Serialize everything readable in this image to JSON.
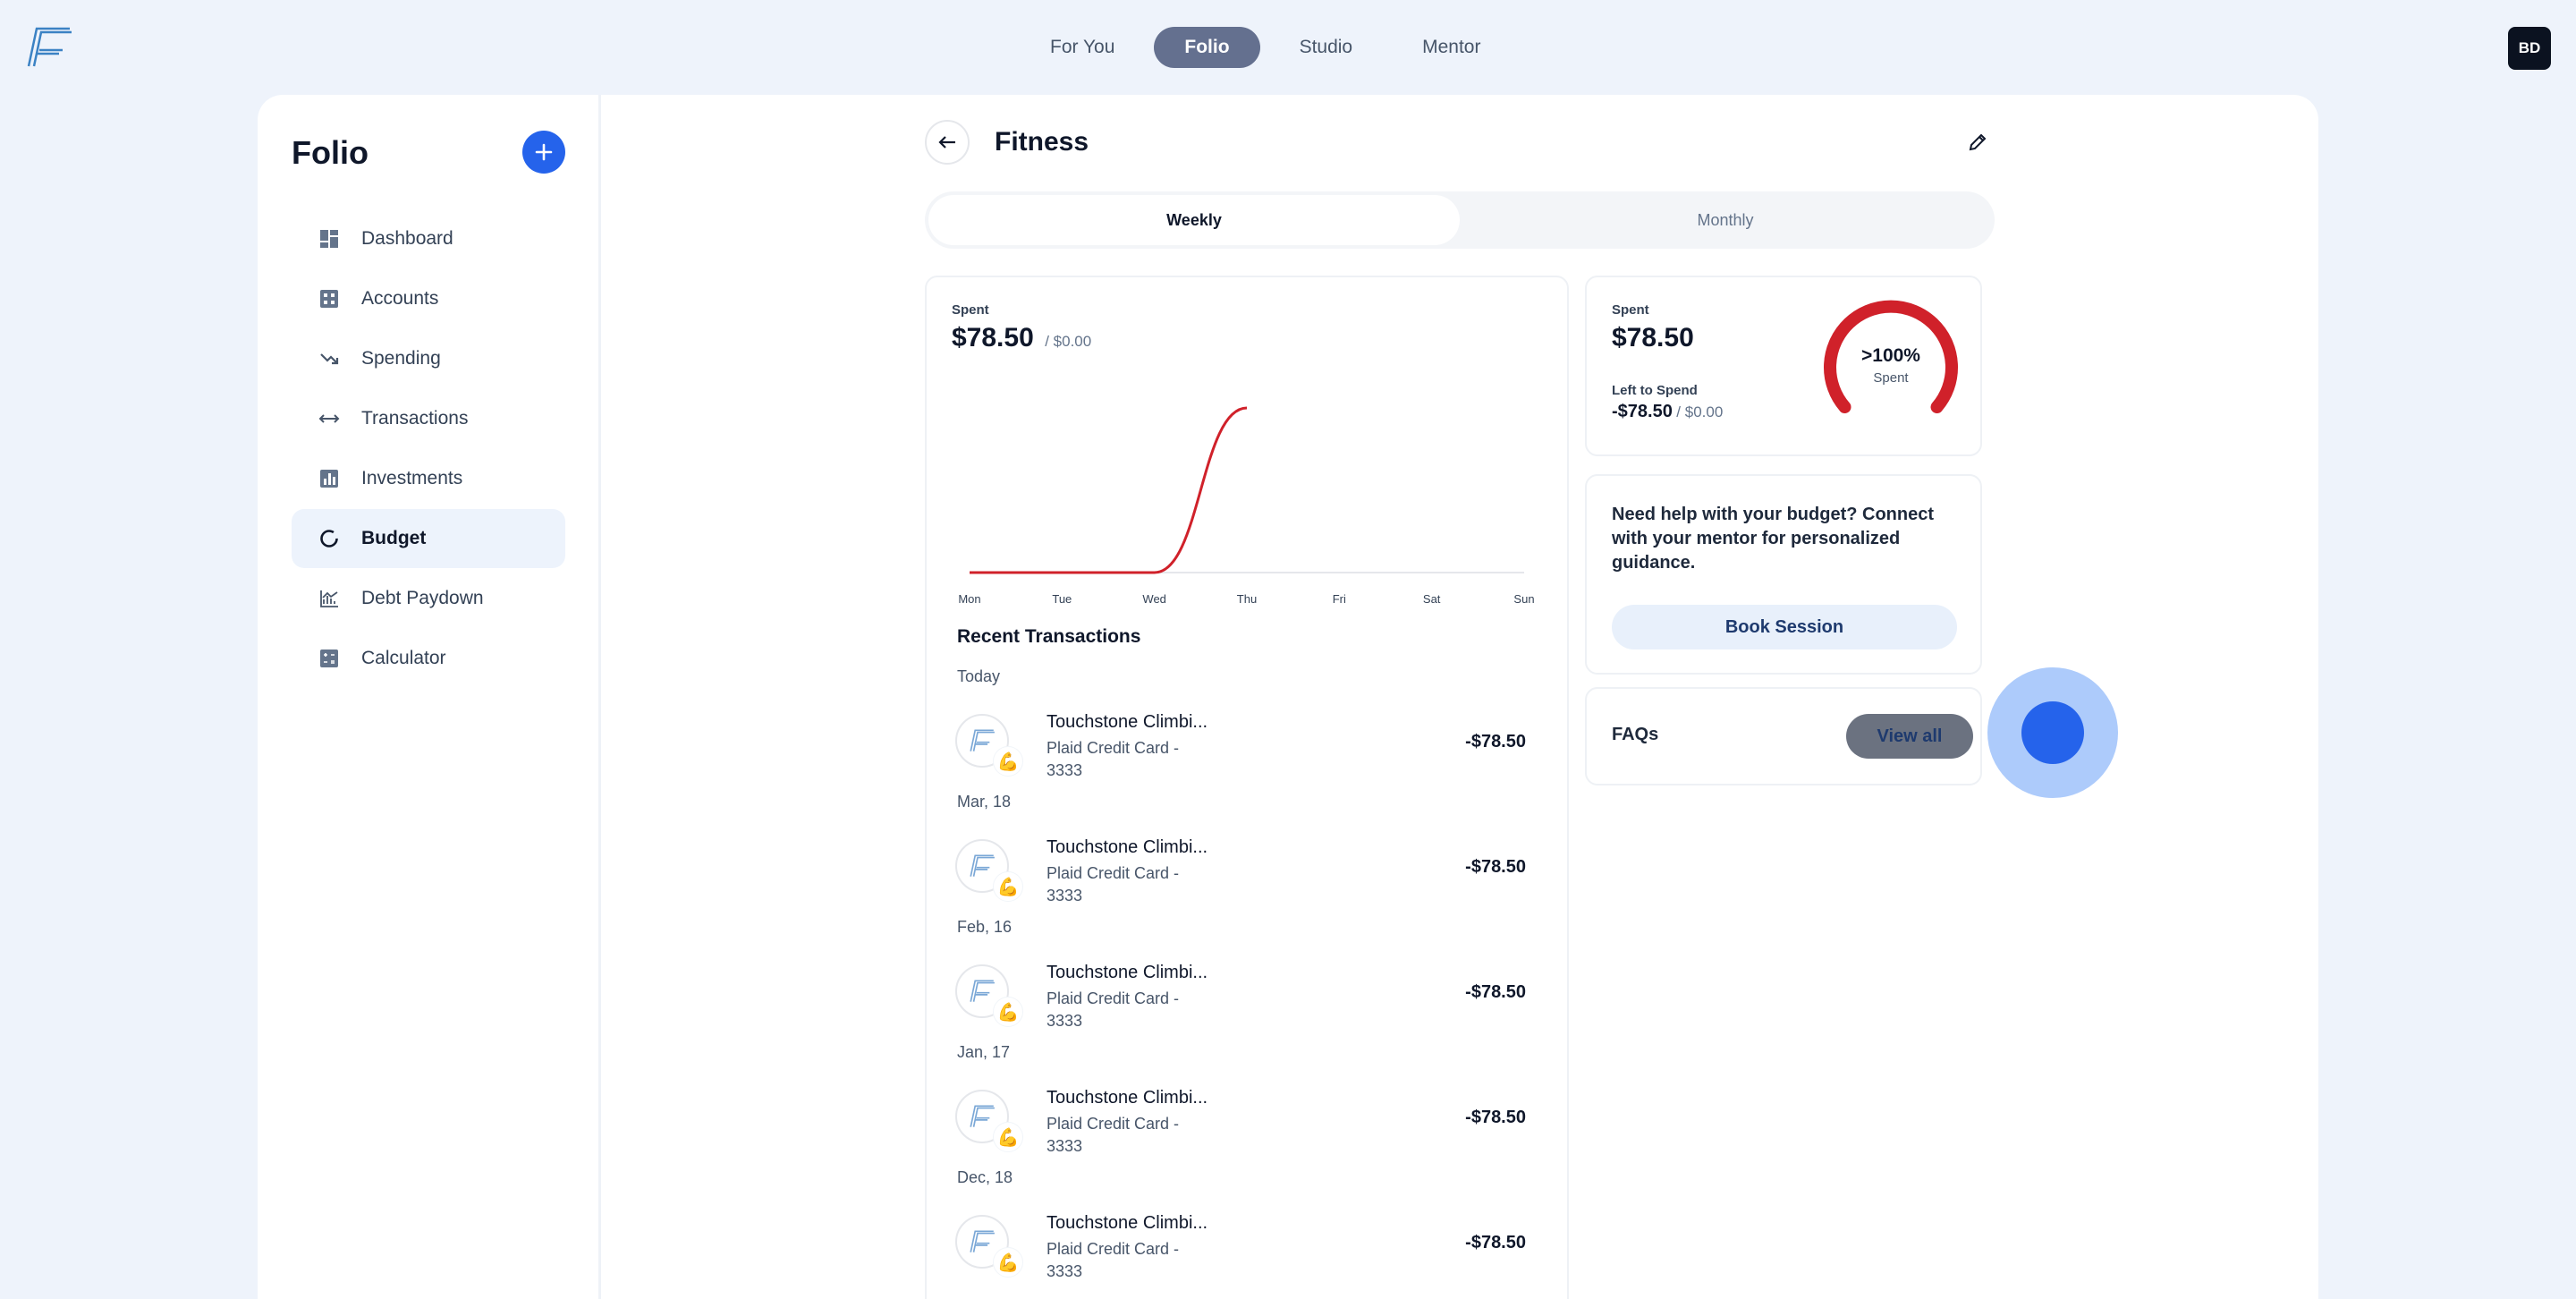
{
  "topnav": {
    "tabs": [
      {
        "label": "For You"
      },
      {
        "label": "Folio",
        "active": true
      },
      {
        "label": "Studio"
      },
      {
        "label": "Mentor"
      }
    ],
    "avatar_initials": "BD"
  },
  "sidebar": {
    "title": "Folio",
    "items": [
      {
        "label": "Dashboard",
        "icon": "dashboard-icon"
      },
      {
        "label": "Accounts",
        "icon": "accounts-icon"
      },
      {
        "label": "Spending",
        "icon": "trend-down-icon"
      },
      {
        "label": "Transactions",
        "icon": "arrows-horizontal-icon"
      },
      {
        "label": "Investments",
        "icon": "bar-chart-icon"
      },
      {
        "label": "Budget",
        "icon": "donut-icon",
        "active": true
      },
      {
        "label": "Debt Paydown",
        "icon": "line-chart-icon"
      },
      {
        "label": "Calculator",
        "icon": "calculator-icon"
      }
    ]
  },
  "page": {
    "title": "Fitness",
    "period_options": [
      "Weekly",
      "Monthly"
    ],
    "active_period": "Weekly"
  },
  "spent_card": {
    "label": "Spent",
    "amount": "$78.50",
    "budget": "/ $0.00"
  },
  "chart_data": {
    "type": "line",
    "categories": [
      "Mon",
      "Tue",
      "Wed",
      "Thu",
      "Fri",
      "Sat",
      "Sun"
    ],
    "series": [
      {
        "values": [
          0,
          0,
          0,
          78.5,
          null,
          null,
          null
        ]
      }
    ],
    "ylim": [
      0,
      78.5
    ],
    "grid": false,
    "color": "#d0212a"
  },
  "recent": {
    "title": "Recent Transactions",
    "groups": [
      {
        "date": "Today",
        "name": "Touchstone Climbi...",
        "account": "Plaid Credit Card - 3333",
        "amount": "-$78.50",
        "emoji": "💪"
      },
      {
        "date": "Mar, 18",
        "name": "Touchstone Climbi...",
        "account": "Plaid Credit Card - 3333",
        "amount": "-$78.50",
        "emoji": "💪"
      },
      {
        "date": "Feb, 16",
        "name": "Touchstone Climbi...",
        "account": "Plaid Credit Card - 3333",
        "amount": "-$78.50",
        "emoji": "💪"
      },
      {
        "date": "Jan, 17",
        "name": "Touchstone Climbi...",
        "account": "Plaid Credit Card - 3333",
        "amount": "-$78.50",
        "emoji": "💪"
      },
      {
        "date": "Dec, 18",
        "name": "Touchstone Climbi...",
        "account": "Plaid Credit Card - 3333",
        "amount": "-$78.50",
        "emoji": "💪"
      }
    ]
  },
  "gauge_card": {
    "spent_label": "Spent",
    "spent_amount": "$78.50",
    "left_label": "Left to Spend",
    "left_amount": "-$78.50",
    "left_budget": "/ $0.00",
    "gauge_text": ">100%",
    "gauge_sub": "Spent",
    "gauge_fraction": 1.0,
    "gauge_color": "#d0212a"
  },
  "help_card": {
    "text": "Need help with your budget? Connect with your mentor for personalized guidance.",
    "button": "Book Session"
  },
  "faq_card": {
    "label": "FAQs",
    "button": "View all"
  }
}
